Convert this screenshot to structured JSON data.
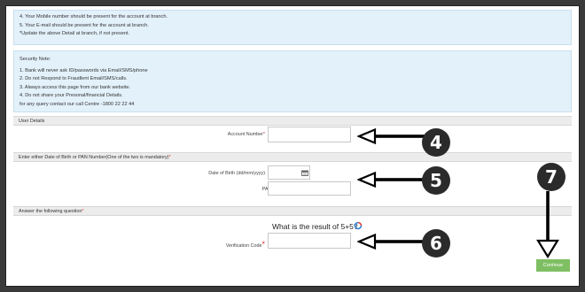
{
  "notes_top": [
    "4. Your Mobile number should be present for the account at branch.",
    "5. Your E-mail should be present for the account at branch.",
    "*Update the above Detail at branch, if not present."
  ],
  "security_note": {
    "title": "Security Note:",
    "lines": [
      "1. Bank will never ask ID/passwords via Email/SMS/phone",
      "2. Do not Respond to Fraudlent Email/SMS/calls.",
      "3. Always access this page from our bank website.",
      "4. Do not share your Presonal/financial Details.",
      "for any query contact our call Centre -1800 22 22 44"
    ]
  },
  "user_details": {
    "heading": "User Details",
    "account_label": "Account Number",
    "account_value": ""
  },
  "dob_pan": {
    "heading": "Enter either Date of Birth or PAN Number(One of the two is mandatory)",
    "dob_label": "Date of Birth (dd/mm/yyyy)",
    "dob_value": "",
    "pan_label": "PAN Number",
    "pan_value": ""
  },
  "question": {
    "heading": "Answer the following question",
    "text": "What is the result of 5+5?",
    "verification_label": "Verification Code",
    "verification_value": ""
  },
  "continue_label": "Continue",
  "annotations": [
    "4",
    "5",
    "6",
    "7"
  ],
  "icons": {
    "calendar": "calendar-icon",
    "refresh": "refresh-icon"
  },
  "colors": {
    "info_bg": "#e3f1fb",
    "button": "#7fbf63",
    "required": "#e03030",
    "annotation": "#2b2b2b",
    "refresh_a": "#e04040",
    "refresh_b": "#2f7fd6"
  }
}
